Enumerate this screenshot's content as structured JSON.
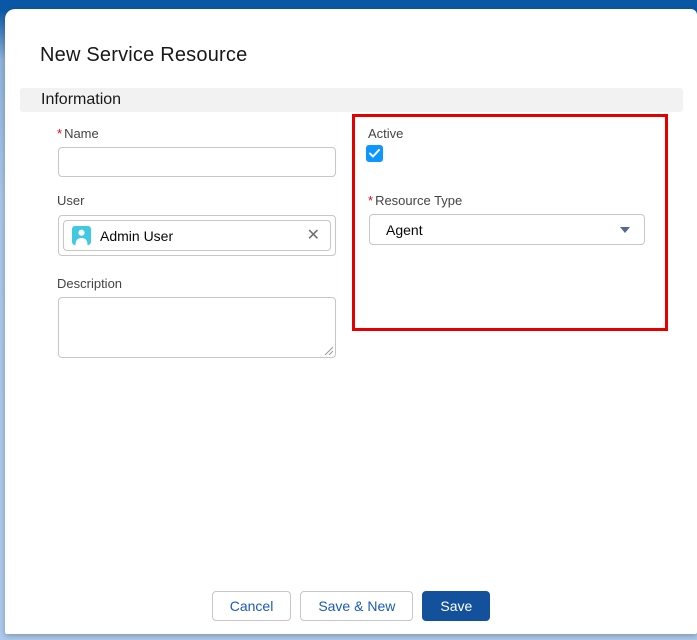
{
  "modal": {
    "title": "New Service Resource",
    "section_title": "Information"
  },
  "form": {
    "required_marker": "*",
    "name": {
      "label": "Name",
      "required": true,
      "value": "",
      "placeholder": ""
    },
    "user": {
      "label": "User",
      "selected_pill": "Admin User",
      "remove_icon": "✕"
    },
    "description": {
      "label": "Description",
      "value": ""
    },
    "active": {
      "label": "Active",
      "checked": true
    },
    "resource_type": {
      "label": "Resource Type",
      "required": true,
      "value": "Agent"
    }
  },
  "footer": {
    "cancel_label": "Cancel",
    "save_new_label": "Save & New",
    "save_label": "Save"
  },
  "annotation": {
    "type": "red-highlight-box",
    "color": "#e50000"
  },
  "colors": {
    "header_bar": "#0a58a5",
    "backdrop": "#adc9ec",
    "section_bg": "#f3f2f2",
    "checkbox_checked": "#0d96ff",
    "avatar_bg": "#41c9e2",
    "brand_button": "#14519c",
    "button_text_blue": "#1a5bb8",
    "required_red": "#ea001e"
  }
}
